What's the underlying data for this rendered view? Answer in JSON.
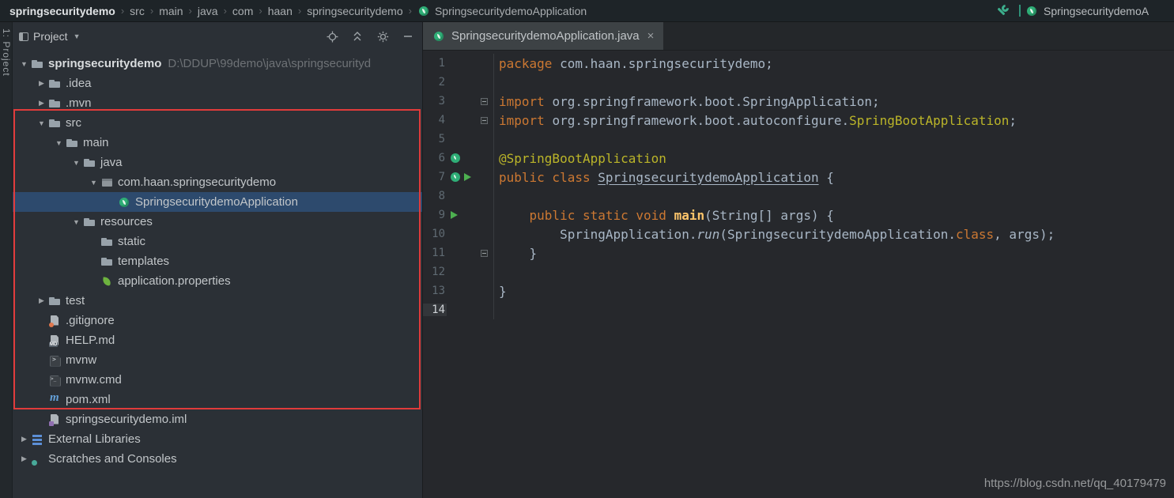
{
  "colors": {
    "selection_blue": "#2d4a6d",
    "annotation_red": "#e03b3b",
    "keyword_orange": "#cc7832",
    "annotation_yellow": "#bbb529",
    "spring_green": "#2fae77",
    "run_green": "#4db050"
  },
  "navbar": {
    "breadcrumbs": [
      {
        "label": "springsecuritydemo",
        "bold": true
      },
      {
        "label": "src"
      },
      {
        "label": "main"
      },
      {
        "label": "java"
      },
      {
        "label": "com"
      },
      {
        "label": "haan"
      },
      {
        "label": "springsecuritydemo"
      },
      {
        "label": "SpringsecuritydemoApplication",
        "icon": "spring"
      }
    ],
    "run_config_label": "SpringsecuritydemoA"
  },
  "left_strip": {
    "project_tool_label": "1: Project"
  },
  "project_panel": {
    "header": {
      "title": "Project",
      "icons": [
        "locate",
        "collapse-all",
        "settings",
        "hide"
      ]
    },
    "tree": [
      {
        "label": "springsecuritydemo",
        "suffix": "D:\\DDUP\\99demo\\java\\springsecurityd",
        "indent": 0,
        "arrow": "down",
        "icon": "folder",
        "bold": true
      },
      {
        "label": ".idea",
        "indent": 1,
        "arrow": "right",
        "icon": "folder"
      },
      {
        "label": ".mvn",
        "indent": 1,
        "arrow": "right",
        "icon": "folder"
      },
      {
        "label": "src",
        "indent": 1,
        "arrow": "down",
        "icon": "folder"
      },
      {
        "label": "main",
        "indent": 2,
        "arrow": "down",
        "icon": "folder"
      },
      {
        "label": "java",
        "indent": 3,
        "arrow": "down",
        "icon": "folder"
      },
      {
        "label": "com.haan.springsecuritydemo",
        "indent": 4,
        "arrow": "down",
        "icon": "package"
      },
      {
        "label": "SpringsecuritydemoApplication",
        "indent": 5,
        "icon": "spring",
        "selected": true
      },
      {
        "label": "resources",
        "indent": 3,
        "arrow": "down",
        "icon": "folder"
      },
      {
        "label": "static",
        "indent": 4,
        "icon": "folder"
      },
      {
        "label": "templates",
        "indent": 4,
        "icon": "folder"
      },
      {
        "label": "application.properties",
        "indent": 4,
        "icon": "leaf"
      },
      {
        "label": "test",
        "indent": 1,
        "arrow": "right",
        "icon": "folder"
      },
      {
        "label": ".gitignore",
        "indent": 1,
        "icon": "file-git"
      },
      {
        "label": "HELP.md",
        "indent": 1,
        "icon": "file-md"
      },
      {
        "label": "mvnw",
        "indent": 1,
        "icon": "file-sh"
      },
      {
        "label": "mvnw.cmd",
        "indent": 1,
        "icon": "file-cmd"
      },
      {
        "label": "pom.xml",
        "indent": 1,
        "icon": "maven"
      },
      {
        "label": "springsecuritydemo.iml",
        "indent": 1,
        "icon": "file-iml"
      },
      {
        "label": "External Libraries",
        "indent": 0,
        "arrow": "right",
        "icon": "libs"
      },
      {
        "label": "Scratches and Consoles",
        "indent": 0,
        "arrow": "right",
        "icon": "scratch"
      }
    ]
  },
  "editor": {
    "tab": {
      "title": "SpringsecuritydemoApplication.java",
      "close_label": "×"
    },
    "code": [
      {
        "n": 1,
        "tokens": [
          [
            "package ",
            "kw"
          ],
          [
            "com.haan.springsecuritydemo;",
            "plain"
          ]
        ]
      },
      {
        "n": 2,
        "tokens": []
      },
      {
        "n": 3,
        "gutter": [
          "fold"
        ],
        "tokens": [
          [
            "import ",
            "kw"
          ],
          [
            "org.springframework.boot.SpringApplication;",
            "plain"
          ]
        ]
      },
      {
        "n": 4,
        "gutter": [
          "fold"
        ],
        "tokens": [
          [
            "import ",
            "kw"
          ],
          [
            "org.springframework.boot.autoconfigure.",
            "plain"
          ],
          [
            "SpringBootApplication",
            "ann"
          ],
          [
            ";",
            "plain"
          ]
        ]
      },
      {
        "n": 5,
        "tokens": []
      },
      {
        "n": 6,
        "gutter": [
          "spring"
        ],
        "tokens": [
          [
            "@SpringBootApplication",
            "ann"
          ]
        ]
      },
      {
        "n": 7,
        "gutter": [
          "spring",
          "run"
        ],
        "tokens": [
          [
            "public class ",
            "kw"
          ],
          [
            "SpringsecuritydemoApplication",
            "plain und"
          ],
          [
            " {",
            "plain"
          ]
        ]
      },
      {
        "n": 8,
        "tokens": []
      },
      {
        "n": 9,
        "gutter": [
          "run"
        ],
        "tokens": [
          [
            "    ",
            "plain"
          ],
          [
            "public static void ",
            "kw"
          ],
          [
            "main",
            "meth"
          ],
          [
            "(String[] args) {",
            "plain"
          ]
        ]
      },
      {
        "n": 10,
        "tokens": [
          [
            "        SpringApplication.",
            "plain"
          ],
          [
            "run",
            "plain ital"
          ],
          [
            "(SpringsecuritydemoApplication.",
            "plain"
          ],
          [
            "class",
            "kw"
          ],
          [
            ", args);",
            "plain"
          ]
        ]
      },
      {
        "n": 11,
        "gutter": [
          "fold"
        ],
        "tokens": [
          [
            "    }",
            "plain"
          ]
        ]
      },
      {
        "n": 12,
        "tokens": []
      },
      {
        "n": 13,
        "tokens": [
          [
            "}",
            "plain"
          ]
        ]
      },
      {
        "n": 14,
        "caret": true,
        "tokens": []
      }
    ]
  },
  "watermark": "https://blog.csdn.net/qq_40179479"
}
